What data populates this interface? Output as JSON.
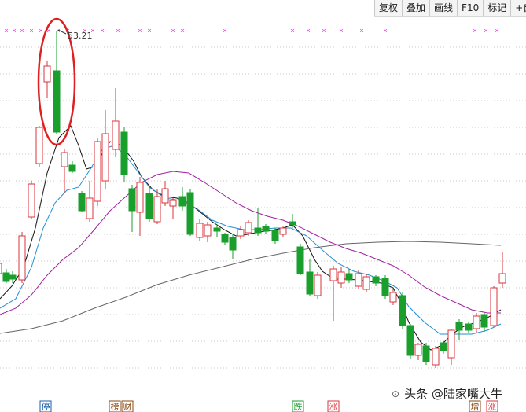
{
  "toolbar": {
    "buttons": [
      "复权",
      "叠加",
      "画线",
      "F10",
      "标记",
      "+自"
    ]
  },
  "chart_data": {
    "type": "candlestick",
    "annotations": {
      "peak_label": "53.21"
    },
    "event_markers": [
      "停",
      "榜",
      "财",
      "跌",
      "涨",
      "增",
      "涨"
    ],
    "colors": {
      "up": "#d9363e",
      "down": "#1a9e2c",
      "ma_short": "#111111",
      "ma_mid": "#1e8fd6",
      "ma_long": "#a020a0",
      "ma_xlong": "#666666",
      "highlight_circle": "#e02020",
      "top_markers": "#e020e0"
    }
  },
  "watermark": {
    "text": "头条 @陆家嘴大牛",
    "icon": "headline-icon"
  }
}
